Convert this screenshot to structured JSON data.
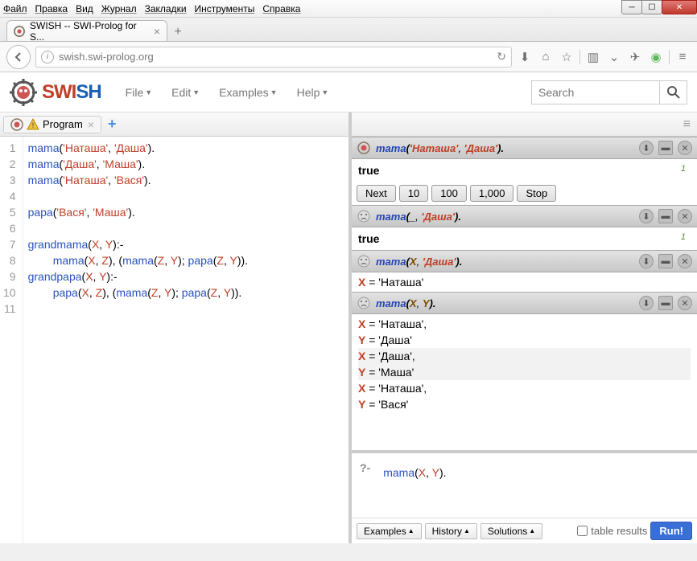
{
  "window": {
    "menus": [
      "Файл",
      "Правка",
      "Вид",
      "Журнал",
      "Закладки",
      "Инструменты",
      "Справка"
    ]
  },
  "browser": {
    "tab_title": "SWISH -- SWI-Prolog for S...",
    "url": "swish.swi-prolog.org"
  },
  "app": {
    "logo_a": "SWI",
    "logo_b": "SH",
    "menus": [
      "File",
      "Edit",
      "Examples",
      "Help"
    ],
    "search_placeholder": "Search"
  },
  "editor": {
    "tab": "Program",
    "lines": [
      {
        "n": "1",
        "t": [
          [
            "pred",
            "mama"
          ],
          [
            "pun",
            "("
          ],
          [
            "str",
            "'Наташа'"
          ],
          [
            "pun",
            ", "
          ],
          [
            "str",
            "'Даша'"
          ],
          [
            "pun",
            ")."
          ]
        ]
      },
      {
        "n": "2",
        "t": [
          [
            "pred",
            "mama"
          ],
          [
            "pun",
            "("
          ],
          [
            "str",
            "'Даша'"
          ],
          [
            "pun",
            ", "
          ],
          [
            "str",
            "'Маша'"
          ],
          [
            "pun",
            ")."
          ]
        ]
      },
      {
        "n": "3",
        "t": [
          [
            "pred",
            "mama"
          ],
          [
            "pun",
            "("
          ],
          [
            "str",
            "'Наташа'"
          ],
          [
            "pun",
            ", "
          ],
          [
            "str",
            "'Вася'"
          ],
          [
            "pun",
            ")."
          ]
        ]
      },
      {
        "n": "4",
        "t": []
      },
      {
        "n": "5",
        "t": [
          [
            "pred",
            "papa"
          ],
          [
            "pun",
            "("
          ],
          [
            "str",
            "'Вася'"
          ],
          [
            "pun",
            ", "
          ],
          [
            "str",
            "'Маша'"
          ],
          [
            "pun",
            ")."
          ]
        ]
      },
      {
        "n": "6",
        "t": []
      },
      {
        "n": "7",
        "t": [
          [
            "pred",
            "grandmama"
          ],
          [
            "pun",
            "("
          ],
          [
            "var",
            "X"
          ],
          [
            "pun",
            ", "
          ],
          [
            "var",
            "Y"
          ],
          [
            "pun",
            "):-"
          ]
        ]
      },
      {
        "n": "8",
        "t": [
          [
            "pad",
            "        "
          ],
          [
            "pred",
            "mama"
          ],
          [
            "pun",
            "("
          ],
          [
            "var",
            "X"
          ],
          [
            "pun",
            ", "
          ],
          [
            "var",
            "Z"
          ],
          [
            "pun",
            "), ("
          ],
          [
            "pred",
            "mama"
          ],
          [
            "pun",
            "("
          ],
          [
            "var",
            "Z"
          ],
          [
            "pun",
            ", "
          ],
          [
            "var",
            "Y"
          ],
          [
            "pun",
            "); "
          ],
          [
            "pred",
            "papa"
          ],
          [
            "pun",
            "("
          ],
          [
            "var",
            "Z"
          ],
          [
            "pun",
            ", "
          ],
          [
            "var",
            "Y"
          ],
          [
            "pun",
            "))."
          ]
        ]
      },
      {
        "n": "9",
        "t": [
          [
            "pred",
            "grandpapa"
          ],
          [
            "pun",
            "("
          ],
          [
            "var",
            "X"
          ],
          [
            "pun",
            ", "
          ],
          [
            "var",
            "Y"
          ],
          [
            "pun",
            "):-"
          ]
        ]
      },
      {
        "n": "10",
        "t": [
          [
            "pad",
            "        "
          ],
          [
            "pred",
            "papa"
          ],
          [
            "pun",
            "("
          ],
          [
            "var",
            "X"
          ],
          [
            "pun",
            ", "
          ],
          [
            "var",
            "Z"
          ],
          [
            "pun",
            "), ("
          ],
          [
            "pred",
            "mama"
          ],
          [
            "pun",
            "("
          ],
          [
            "var",
            "Z"
          ],
          [
            "pun",
            ", "
          ],
          [
            "var",
            "Y"
          ],
          [
            "pun",
            "); "
          ],
          [
            "pred",
            "papa"
          ],
          [
            "pun",
            "("
          ],
          [
            "var",
            "Z"
          ],
          [
            "pun",
            ", "
          ],
          [
            "var",
            "Y"
          ],
          [
            "pun",
            "))."
          ]
        ]
      },
      {
        "n": "11",
        "t": []
      }
    ]
  },
  "queries": [
    {
      "icon": "owl",
      "fn": "mama",
      "args": [
        [
          "str",
          "'Наташа'"
        ],
        [
          "str",
          "'Даша'"
        ]
      ],
      "answers": {
        "true": true,
        "idx": "1",
        "paging": [
          "Next",
          "10",
          "100",
          "1,000",
          "Stop"
        ]
      }
    },
    {
      "icon": "sad",
      "fn": "mama",
      "args": [
        [
          "pun",
          "_"
        ],
        [
          "str",
          "'Даша'"
        ]
      ],
      "answers": {
        "true": true,
        "idx": "1"
      }
    },
    {
      "icon": "sad",
      "fn": "mama",
      "args": [
        [
          "var",
          "X"
        ],
        [
          "str",
          "'Даша'"
        ]
      ],
      "answers": {
        "bindings": [
          [
            {
              "v": "X",
              "val": "'Наташа'"
            }
          ]
        ]
      }
    },
    {
      "icon": "sad",
      "fn": "mama",
      "args": [
        [
          "var",
          "X"
        ],
        [
          "var",
          "Y"
        ]
      ],
      "answers": {
        "bindings": [
          [
            {
              "v": "X",
              "val": "'Наташа'",
              "c": ","
            },
            {
              "v": "Y",
              "val": "'Даша'"
            }
          ],
          [
            {
              "v": "X",
              "val": "'Даша'",
              "c": ","
            },
            {
              "v": "Y",
              "val": "'Маша'"
            }
          ],
          [
            {
              "v": "X",
              "val": "'Наташа'",
              "c": ","
            },
            {
              "v": "Y",
              "val": "'Вася'"
            }
          ]
        ]
      }
    }
  ],
  "query_input": {
    "prompt": "?-",
    "tokens": [
      [
        "pred",
        "mama"
      ],
      [
        "pun",
        "("
      ],
      [
        "var",
        "X"
      ],
      [
        "pun",
        ", "
      ],
      [
        "var",
        "Y"
      ],
      [
        "pun",
        "). "
      ]
    ]
  },
  "footer": {
    "buttons": [
      "Examples",
      "History",
      "Solutions"
    ],
    "table_results": "table results",
    "run": "Run!"
  }
}
